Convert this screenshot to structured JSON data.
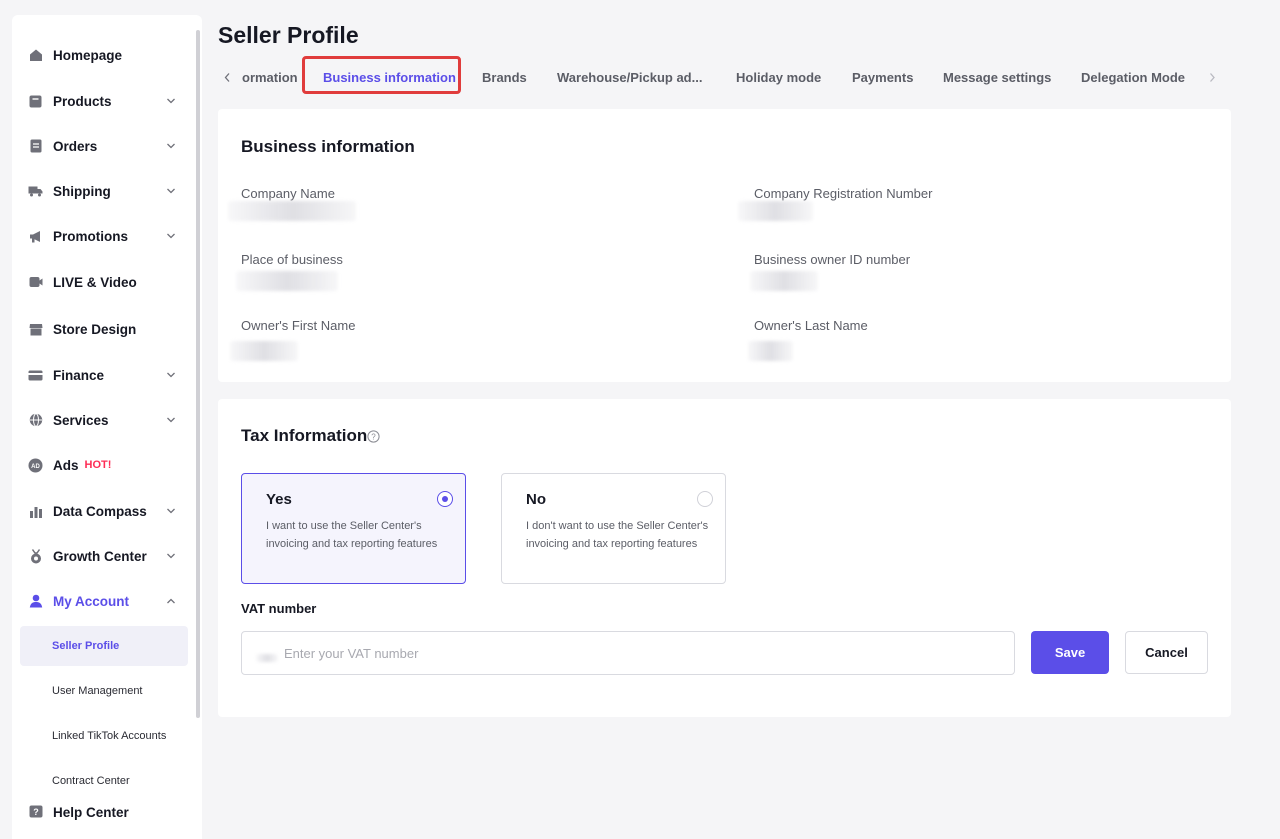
{
  "page": {
    "title": "Seller Profile"
  },
  "sidebar": {
    "items": [
      {
        "label": "Homepage",
        "icon": "home-icon",
        "expandable": false
      },
      {
        "label": "Products",
        "icon": "products-icon",
        "expandable": true
      },
      {
        "label": "Orders",
        "icon": "orders-icon",
        "expandable": true
      },
      {
        "label": "Shipping",
        "icon": "truck-icon",
        "expandable": true
      },
      {
        "label": "Promotions",
        "icon": "megaphone-icon",
        "expandable": true
      },
      {
        "label": "LIVE & Video",
        "icon": "video-icon",
        "expandable": false
      },
      {
        "label": "Store Design",
        "icon": "store-icon",
        "expandable": false
      },
      {
        "label": "Finance",
        "icon": "card-icon",
        "expandable": true
      },
      {
        "label": "Services",
        "icon": "globe-icon",
        "expandable": true
      },
      {
        "label": "Ads",
        "icon": "ad-icon",
        "expandable": false,
        "badge": "HOT!"
      },
      {
        "label": "Data Compass",
        "icon": "chart-icon",
        "expandable": true
      },
      {
        "label": "Growth Center",
        "icon": "medal-icon",
        "expandable": true
      },
      {
        "label": "My Account",
        "icon": "user-icon",
        "expandable": true,
        "expanded": true,
        "active": true
      }
    ],
    "subitems": [
      {
        "label": "Seller Profile",
        "active": true
      },
      {
        "label": "User Management"
      },
      {
        "label": "Linked TikTok Accounts"
      },
      {
        "label": "Contract Center"
      }
    ],
    "help": {
      "label": "Help Center",
      "icon": "help-icon"
    }
  },
  "tabs": [
    {
      "label": "ormation"
    },
    {
      "label": "Business information",
      "active": true
    },
    {
      "label": "Brands"
    },
    {
      "label": "Warehouse/Pickup ad..."
    },
    {
      "label": "Holiday mode"
    },
    {
      "label": "Payments"
    },
    {
      "label": "Message settings"
    },
    {
      "label": "Delegation Mode"
    }
  ],
  "business": {
    "title": "Business information",
    "fields": {
      "company_name": "Company Name",
      "company_reg": "Company Registration Number",
      "place": "Place of business",
      "owner_id": "Business owner ID number",
      "first_name": "Owner's First Name",
      "last_name": "Owner's Last Name"
    }
  },
  "tax": {
    "title": "Tax Information",
    "yes": {
      "title": "Yes",
      "desc": "I want to use the Seller Center's invoicing and tax reporting features",
      "selected": true
    },
    "no": {
      "title": "No",
      "desc": "I don't want to use the Seller Center's invoicing and tax reporting features",
      "selected": false
    },
    "vat_label": "VAT number",
    "vat_placeholder": "Enter your VAT number",
    "save": "Save",
    "cancel": "Cancel"
  },
  "colors": {
    "accent": "#5b4ee8",
    "highlight": "#e03c3c",
    "hot": "#fe2c55"
  }
}
